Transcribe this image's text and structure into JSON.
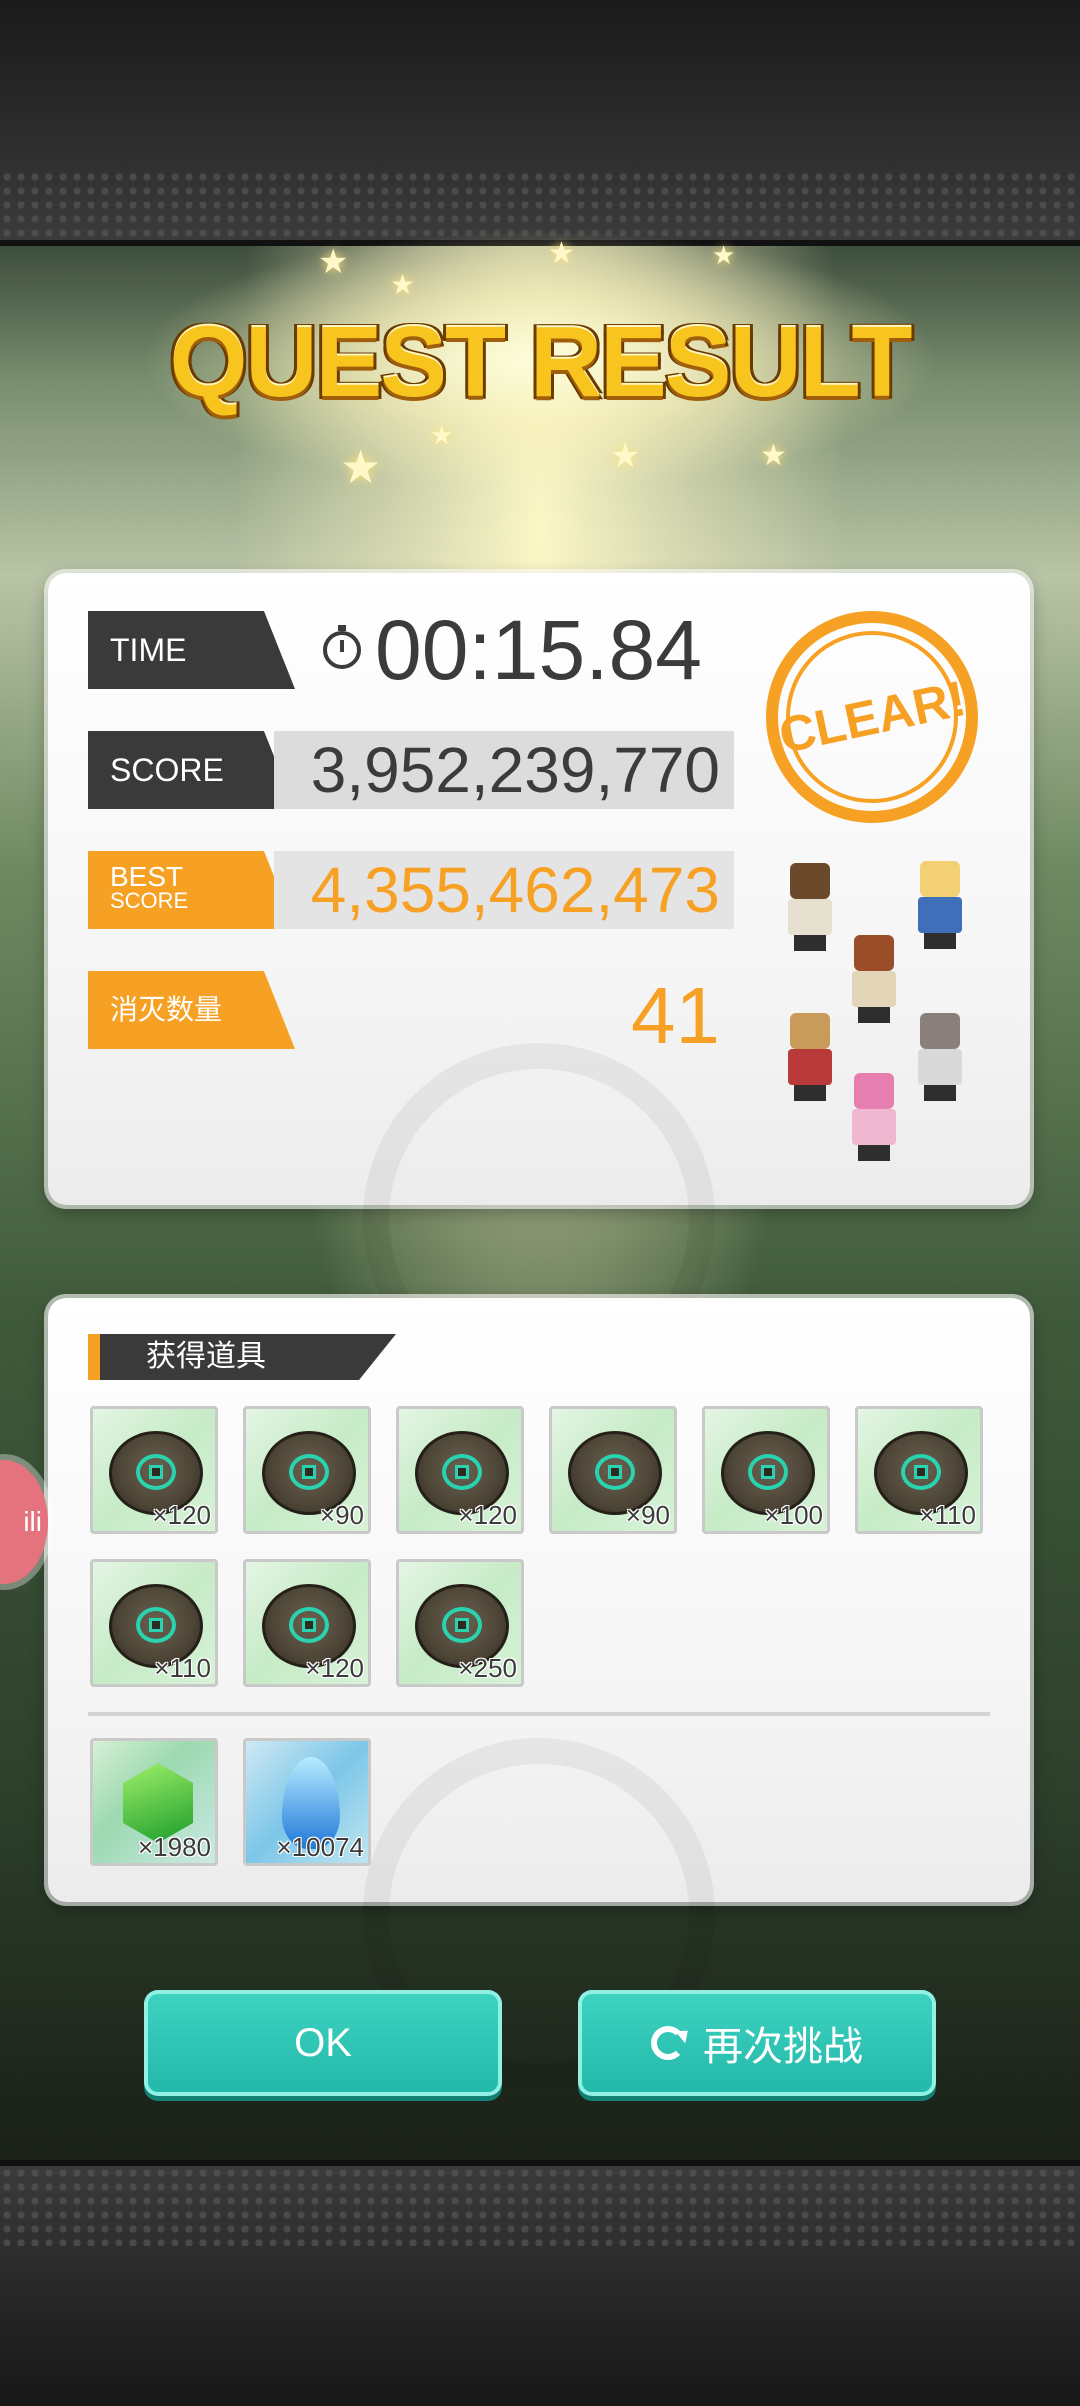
{
  "title": "QUEST RESULT",
  "result": {
    "time_label": "TIME",
    "time_value": "00:15.84",
    "score_label": "SCORE",
    "score_value": "3,952,239,770",
    "best_label_1": "BEST",
    "best_label_2": "SCORE",
    "best_value": "4,355,462,473",
    "kills_label": "消灭数量",
    "kills_value": "41",
    "clear_stamp": "CLEAR!"
  },
  "items": {
    "header": "获得道具",
    "medals": [
      {
        "qty": "×120"
      },
      {
        "qty": "×90"
      },
      {
        "qty": "×120"
      },
      {
        "qty": "×90"
      },
      {
        "qty": "×100"
      },
      {
        "qty": "×110"
      },
      {
        "qty": "×110"
      },
      {
        "qty": "×120"
      },
      {
        "qty": "×250"
      }
    ],
    "special": [
      {
        "icon": "green-gem-icon",
        "qty": "×1980"
      },
      {
        "icon": "blue-flame-icon",
        "qty": "×10074"
      }
    ]
  },
  "buttons": {
    "ok": "OK",
    "retry": "再次挑战"
  },
  "side_badge": "ili",
  "colors": {
    "accent_orange": "#f7a124",
    "button_teal": "#2ec4b4",
    "dark_label": "#3a3a3a"
  }
}
